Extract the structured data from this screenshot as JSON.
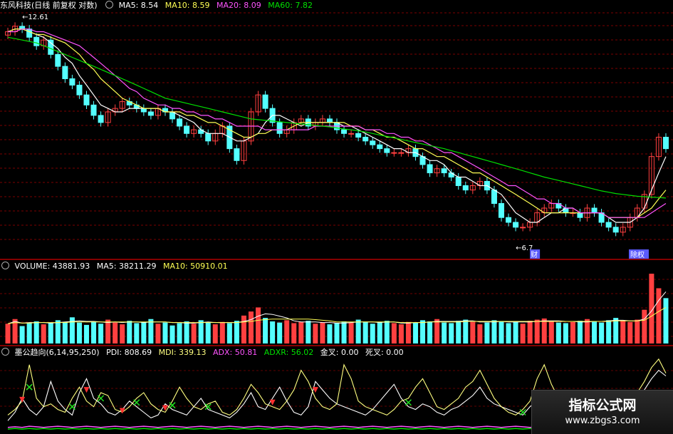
{
  "header": {
    "title": "东风科技(日线 前复权 对数)",
    "ma5": "MA5: 8.54",
    "ma10": "MA10: 8.59",
    "ma20": "MA20: 8.09",
    "ma60": "MA60: 7.82"
  },
  "volume_header": {
    "volume": "VOLUME: 43881.93",
    "ma5": "MA5: 38211.29",
    "ma10": "MA10: 50910.01"
  },
  "indicator_header": {
    "name": "墨公趋向(6,14,95,250)",
    "pdi": "PDI: 808.69",
    "mdi": "MDI: 339.13",
    "adx": "ADX: 50.81",
    "adxr": "ADXR: 56.02",
    "jincha": "金叉: 0.00",
    "sicha": "死叉: 0.00"
  },
  "watermark": {
    "title": "指标公式网",
    "url": "www.zbgs3.com"
  },
  "colors": {
    "up": "#ff4040",
    "down": "#54ffff",
    "ma5": "#ffffff",
    "ma10": "#ffff54",
    "ma20": "#ff54ff",
    "ma60": "#00e000",
    "grid": "#8b0000",
    "pdi": "#ffffff",
    "mdi": "#ffff80",
    "adx": "#ff54ff",
    "adxr": "#00e000"
  },
  "chart_data": [
    {
      "type": "candlestick",
      "title": "东风科技(日线 前复权 对数)",
      "log_scale": true,
      "annotations": [
        {
          "label": "12.61",
          "kind": "high"
        },
        {
          "label": "6.7",
          "kind": "low"
        },
        {
          "label": "财",
          "kind": "marker"
        },
        {
          "label": "除权",
          "kind": "marker"
        }
      ],
      "close": [
        12.2,
        12.4,
        12.3,
        12.0,
        11.7,
        11.9,
        11.4,
        11.0,
        10.6,
        10.4,
        10.1,
        9.8,
        9.5,
        9.3,
        9.6,
        9.7,
        9.9,
        9.8,
        9.7,
        9.6,
        9.5,
        9.7,
        9.6,
        9.4,
        9.2,
        9.0,
        9.1,
        9.0,
        8.8,
        9.0,
        9.2,
        8.6,
        8.3,
        8.8,
        9.6,
        10.1,
        9.7,
        9.3,
        9.0,
        9.1,
        9.3,
        9.4,
        9.2,
        9.3,
        9.4,
        9.3,
        9.1,
        9.0,
        9.0,
        8.9,
        8.8,
        8.7,
        8.6,
        8.5,
        8.5,
        8.5,
        8.6,
        8.4,
        8.2,
        8.0,
        8.1,
        8.0,
        7.9,
        7.7,
        7.6,
        7.7,
        7.8,
        7.6,
        7.3,
        7.0,
        6.9,
        6.8,
        6.8,
        6.9,
        7.1,
        7.2,
        7.3,
        7.2,
        7.1,
        7.1,
        7.0,
        7.2,
        7.1,
        6.9,
        6.8,
        6.7,
        6.8,
        7.0,
        7.2,
        7.5,
        8.4,
        8.9,
        8.6
      ],
      "series": [
        {
          "name": "MA5",
          "values": [
            12.2,
            12.3,
            12.3,
            12.2,
            12.1,
            12.0,
            11.8,
            11.6,
            11.3,
            11.1,
            10.7,
            10.4,
            10.1,
            9.8,
            9.7,
            9.6,
            9.6,
            9.7,
            9.7,
            9.7,
            9.7,
            9.7,
            9.6,
            9.6,
            9.5,
            9.4,
            9.3,
            9.1,
            9.0,
            9.0,
            9.0,
            8.9,
            8.8,
            8.8,
            8.9,
            9.0,
            9.3,
            9.5,
            9.5,
            9.4,
            9.3,
            9.2,
            9.3,
            9.3,
            9.3,
            9.3,
            9.3,
            9.2,
            9.2,
            9.1,
            9.0,
            8.9,
            8.8,
            8.7,
            8.6,
            8.6,
            8.5,
            8.5,
            8.4,
            8.3,
            8.3,
            8.2,
            8.0,
            7.9,
            7.9,
            7.8,
            7.7,
            7.7,
            7.6,
            7.5,
            7.3,
            7.1,
            7.0,
            6.9,
            6.9,
            7.0,
            7.1,
            7.1,
            7.2,
            7.2,
            7.1,
            7.1,
            7.1,
            7.1,
            7.0,
            6.9,
            6.9,
            6.9,
            7.0,
            7.2,
            7.6,
            8.0,
            8.4
          ]
        },
        {
          "name": "MA10",
          "values": [
            12.2,
            12.3,
            12.3,
            12.2,
            12.1,
            12.1,
            12.0,
            11.9,
            11.8,
            11.6,
            11.4,
            11.1,
            10.9,
            10.6,
            10.4,
            10.2,
            10.0,
            9.9,
            9.8,
            9.7,
            9.7,
            9.7,
            9.6,
            9.6,
            9.6,
            9.5,
            9.5,
            9.4,
            9.3,
            9.3,
            9.2,
            9.1,
            9.0,
            8.9,
            8.9,
            9.0,
            9.0,
            9.1,
            9.1,
            9.1,
            9.2,
            9.3,
            9.3,
            9.3,
            9.3,
            9.3,
            9.3,
            9.3,
            9.2,
            9.2,
            9.1,
            9.1,
            9.0,
            8.9,
            8.9,
            8.8,
            8.7,
            8.6,
            8.6,
            8.5,
            8.4,
            8.4,
            8.3,
            8.2,
            8.1,
            8.0,
            8.0,
            7.9,
            7.8,
            7.7,
            7.6,
            7.5,
            7.4,
            7.3,
            7.2,
            7.1,
            7.1,
            7.1,
            7.1,
            7.1,
            7.1,
            7.1,
            7.1,
            7.1,
            7.0,
            7.0,
            7.0,
            7.0,
            7.0,
            7.1,
            7.2,
            7.4,
            7.6
          ]
        },
        {
          "name": "MA20",
          "values": [
            12.2,
            12.2,
            12.3,
            12.3,
            12.2,
            12.2,
            12.1,
            12.0,
            11.9,
            11.8,
            11.7,
            11.5,
            11.3,
            11.1,
            10.9,
            10.7,
            10.5,
            10.3,
            10.2,
            10.0,
            9.9,
            9.8,
            9.8,
            9.7,
            9.7,
            9.6,
            9.6,
            9.5,
            9.5,
            9.4,
            9.4,
            9.3,
            9.2,
            9.2,
            9.2,
            9.2,
            9.1,
            9.1,
            9.1,
            9.1,
            9.1,
            9.1,
            9.1,
            9.2,
            9.2,
            9.2,
            9.2,
            9.2,
            9.2,
            9.2,
            9.1,
            9.1,
            9.1,
            9.0,
            9.0,
            8.9,
            8.9,
            8.8,
            8.8,
            8.7,
            8.6,
            8.5,
            8.5,
            8.4,
            8.3,
            8.2,
            8.1,
            8.0,
            7.9,
            7.8,
            7.7,
            7.7,
            7.6,
            7.5,
            7.4,
            7.4,
            7.3,
            7.3,
            7.2,
            7.2,
            7.1,
            7.1,
            7.1,
            7.1,
            7.0,
            7.0,
            7.0,
            7.0,
            7.0,
            7.0,
            7.1,
            7.2,
            7.3
          ]
        },
        {
          "name": "MA60",
          "values": [
            12.0,
            11.95,
            11.9,
            11.85,
            11.8,
            11.7,
            11.6,
            11.5,
            11.4,
            11.3,
            11.2,
            11.1,
            11.0,
            10.9,
            10.8,
            10.7,
            10.6,
            10.5,
            10.4,
            10.3,
            10.2,
            10.1,
            10.0,
            9.95,
            9.9,
            9.85,
            9.8,
            9.75,
            9.7,
            9.65,
            9.6,
            9.55,
            9.5,
            9.45,
            9.4,
            9.38,
            9.36,
            9.34,
            9.32,
            9.3,
            9.28,
            9.26,
            9.24,
            9.22,
            9.2,
            9.18,
            9.15,
            9.12,
            9.1,
            9.07,
            9.04,
            9.0,
            8.96,
            8.92,
            8.88,
            8.84,
            8.8,
            8.76,
            8.72,
            8.68,
            8.64,
            8.6,
            8.55,
            8.5,
            8.45,
            8.4,
            8.35,
            8.3,
            8.25,
            8.2,
            8.15,
            8.1,
            8.05,
            8.0,
            7.95,
            7.9,
            7.86,
            7.82,
            7.78,
            7.74,
            7.7,
            7.66,
            7.62,
            7.58,
            7.55,
            7.52,
            7.5,
            7.48,
            7.46,
            7.45,
            7.44,
            7.43,
            7.42
          ]
        }
      ]
    },
    {
      "type": "bar",
      "title": "VOLUME",
      "values": [
        34,
        42,
        30,
        36,
        38,
        33,
        35,
        40,
        37,
        45,
        36,
        32,
        38,
        34,
        41,
        36,
        33,
        39,
        35,
        37,
        42,
        34,
        36,
        31,
        35,
        38,
        34,
        40,
        36,
        33,
        37,
        35,
        39,
        48,
        55,
        62,
        44,
        38,
        36,
        40,
        35,
        37,
        39,
        34,
        36,
        33,
        35,
        38,
        36,
        41,
        37,
        34,
        36,
        39,
        35,
        33,
        37,
        36,
        40,
        38,
        42,
        36,
        35,
        39,
        41,
        37,
        33,
        36,
        40,
        38,
        35,
        37,
        34,
        39,
        41,
        43,
        38,
        36,
        35,
        37,
        39,
        42,
        38,
        36,
        40,
        44,
        39,
        37,
        41,
        58,
        120,
        95,
        78
      ],
      "series": [
        {
          "name": "MA5",
          "values": [
            34,
            38,
            35,
            36,
            36,
            36,
            35,
            36,
            37,
            38,
            39,
            38,
            38,
            37,
            36,
            37,
            36,
            37,
            37,
            36,
            37,
            37,
            37,
            36,
            36,
            35,
            35,
            36,
            37,
            36,
            36,
            36,
            36,
            38,
            41,
            47,
            51,
            50,
            47,
            44,
            39,
            37,
            37,
            37,
            36,
            36,
            35,
            35,
            36,
            37,
            37,
            37,
            36,
            37,
            37,
            35,
            35,
            36,
            36,
            37,
            38,
            38,
            38,
            38,
            39,
            39,
            37,
            37,
            37,
            38,
            37,
            37,
            37,
            37,
            38,
            39,
            39,
            39,
            38,
            38,
            37,
            37,
            38,
            38,
            39,
            40,
            40,
            39,
            39,
            42,
            56,
            74,
            89
          ]
        },
        {
          "name": "MA10",
          "values": [
            34,
            36,
            35,
            35,
            36,
            36,
            36,
            36,
            36,
            37,
            37,
            37,
            37,
            37,
            37,
            37,
            37,
            37,
            37,
            37,
            37,
            37,
            37,
            36,
            36,
            36,
            36,
            36,
            36,
            36,
            36,
            36,
            36,
            37,
            38,
            40,
            41,
            42,
            42,
            42,
            42,
            42,
            42,
            41,
            40,
            39,
            37,
            37,
            37,
            37,
            37,
            37,
            37,
            37,
            37,
            36,
            36,
            36,
            36,
            37,
            37,
            37,
            37,
            37,
            38,
            38,
            38,
            38,
            38,
            38,
            38,
            38,
            38,
            38,
            38,
            38,
            38,
            38,
            38,
            38,
            38,
            38,
            38,
            38,
            38,
            39,
            39,
            39,
            39,
            40,
            47,
            55,
            62
          ]
        }
      ]
    },
    {
      "type": "line",
      "title": "墨公趋向(6,14,95,250)",
      "series": [
        {
          "name": "PDI",
          "values": [
            20,
            35,
            60,
            40,
            30,
            45,
            90,
            55,
            40,
            30,
            70,
            95,
            60,
            50,
            35,
            30,
            40,
            55,
            45,
            35,
            25,
            30,
            50,
            40,
            35,
            30,
            45,
            60,
            40,
            35,
            30,
            25,
            35,
            50,
            70,
            45,
            40,
            60,
            80,
            55,
            35,
            30,
            45,
            90,
            75,
            60,
            50,
            45,
            40,
            35,
            30,
            40,
            55,
            70,
            85,
            60,
            45,
            40,
            50,
            45,
            35,
            30,
            40,
            45,
            55,
            65,
            80,
            60,
            50,
            45,
            40,
            35,
            30,
            45,
            55,
            50,
            40,
            35,
            30,
            28,
            35,
            40,
            45,
            50,
            40,
            35,
            40,
            45,
            60,
            75,
            95,
            110,
            100
          ]
        },
        {
          "name": "MDI",
          "values": [
            30,
            40,
            55,
            120,
            60,
            45,
            50,
            40,
            35,
            60,
            80,
            55,
            45,
            70,
            65,
            40,
            35,
            45,
            60,
            70,
            50,
            40,
            35,
            55,
            80,
            60,
            45,
            40,
            50,
            55,
            35,
            30,
            40,
            60,
            85,
            70,
            50,
            45,
            40,
            55,
            75,
            110,
            90,
            60,
            45,
            40,
            50,
            120,
            95,
            55,
            45,
            40,
            35,
            30,
            40,
            55,
            60,
            80,
            95,
            70,
            45,
            40,
            50,
            60,
            80,
            90,
            110,
            85,
            60,
            45,
            35,
            30,
            40,
            55,
            95,
            120,
            85,
            60,
            45,
            40,
            50,
            55,
            45,
            40,
            35,
            30,
            40,
            50,
            70,
            90,
            115,
            130,
            105
          ]
        },
        {
          "name": "ADX",
          "values": [
            8,
            9,
            8,
            10,
            9,
            8,
            9,
            10,
            9,
            8,
            9,
            10,
            9,
            8,
            9,
            10,
            9,
            8,
            9,
            10,
            9,
            8,
            9,
            10,
            9,
            8,
            9,
            10,
            9,
            8,
            9,
            10,
            9,
            8,
            9,
            10,
            9,
            8,
            9,
            10,
            9,
            8,
            9,
            10,
            9,
            8,
            9,
            10,
            9,
            8,
            9,
            10,
            9,
            8,
            9,
            10,
            9,
            8,
            9,
            10,
            9,
            8,
            9,
            10,
            9,
            8,
            9,
            10,
            9,
            8,
            9,
            10,
            9,
            8,
            9,
            10,
            9,
            8,
            9,
            10,
            9,
            8,
            9,
            10,
            9,
            8,
            9,
            10,
            9,
            8,
            9,
            10,
            9
          ]
        },
        {
          "name": "ADXR",
          "values": [
            5,
            6,
            5,
            6,
            5,
            6,
            5,
            6,
            5,
            6,
            5,
            6,
            5,
            6,
            5,
            6,
            5,
            6,
            5,
            6,
            5,
            6,
            5,
            6,
            5,
            6,
            5,
            6,
            5,
            6,
            5,
            6,
            5,
            6,
            5,
            6,
            5,
            6,
            5,
            6,
            5,
            6,
            5,
            6,
            5,
            6,
            5,
            6,
            5,
            6,
            5,
            6,
            5,
            6,
            5,
            6,
            5,
            6,
            5,
            6,
            5,
            6,
            5,
            6,
            5,
            6,
            5,
            6,
            5,
            6,
            5,
            6,
            5,
            6,
            5,
            6,
            5,
            6,
            5,
            6,
            5,
            6,
            5,
            6,
            5,
            6,
            5,
            6,
            5,
            6,
            5,
            6,
            5
          ]
        }
      ]
    }
  ]
}
